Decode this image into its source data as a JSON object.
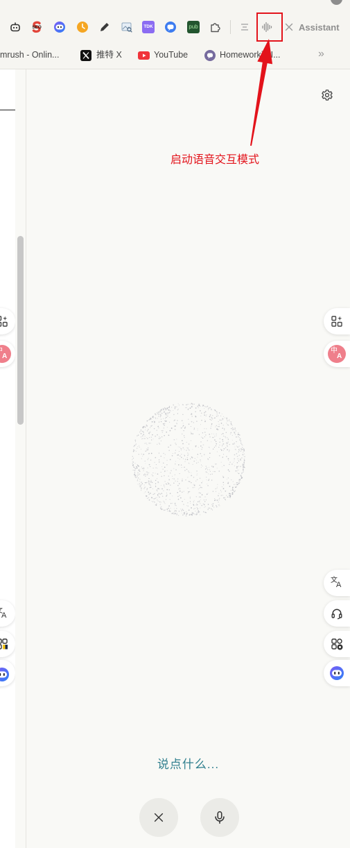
{
  "browser": {
    "toolbar": {
      "extension_icons": [
        "robot-icon",
        "seo-icon",
        "bot-face-icon",
        "clock-icon",
        "pencil-icon",
        "image-search-icon",
        "tdk-icon",
        "chat-circle-icon",
        "pub-icon",
        "puzzle-icon"
      ],
      "seo_label": "SEO",
      "tdk_label": "TDK",
      "pub_label": "pub",
      "sidepanel_icons": [
        "list-icon",
        "waveform-icon",
        "close-icon"
      ],
      "sidepanel_title": "Assistant"
    },
    "bookmarks": {
      "items": [
        {
          "label": "mrush - Onlin...",
          "icon": null
        },
        {
          "label": "推特 X",
          "icon": "x-logo-icon"
        },
        {
          "label": "YouTube",
          "icon": "youtube-icon"
        },
        {
          "label": "Homeworki AI...",
          "icon": "homework-icon"
        }
      ],
      "overflow": "»"
    }
  },
  "annotation": {
    "text": "启动语音交互模式",
    "color": "#e3131b"
  },
  "assistant": {
    "settings_icon": "gear-icon",
    "voice_prompt": "说点什么...",
    "prompt_color": "#2f7f8e",
    "controls": [
      {
        "icon": "close-icon"
      },
      {
        "icon": "microphone-icon"
      }
    ]
  },
  "floating_tools": {
    "right_icons": [
      "sparkle-grid-icon",
      "translate-badge-icon",
      "translate-icon",
      "headset-icon",
      "apps-grid-icon",
      "bot-face-icon"
    ],
    "left_icons": [
      "sparkle-grid-icon",
      "translate-badge-icon",
      "translate-icon",
      "apps-grid-icon",
      "bot-face-icon"
    ],
    "translate_badge": {
      "cn": "中",
      "en": "A",
      "color": "#ef7f8b"
    },
    "translate_icon": {
      "cn": "文",
      "en": "A"
    }
  },
  "theme": {
    "panel_background": "#f9f9f6",
    "toolbar_background": "#f6f5f1",
    "bot_gradient": [
      "#7b5cf5",
      "#2f80f6"
    ]
  }
}
